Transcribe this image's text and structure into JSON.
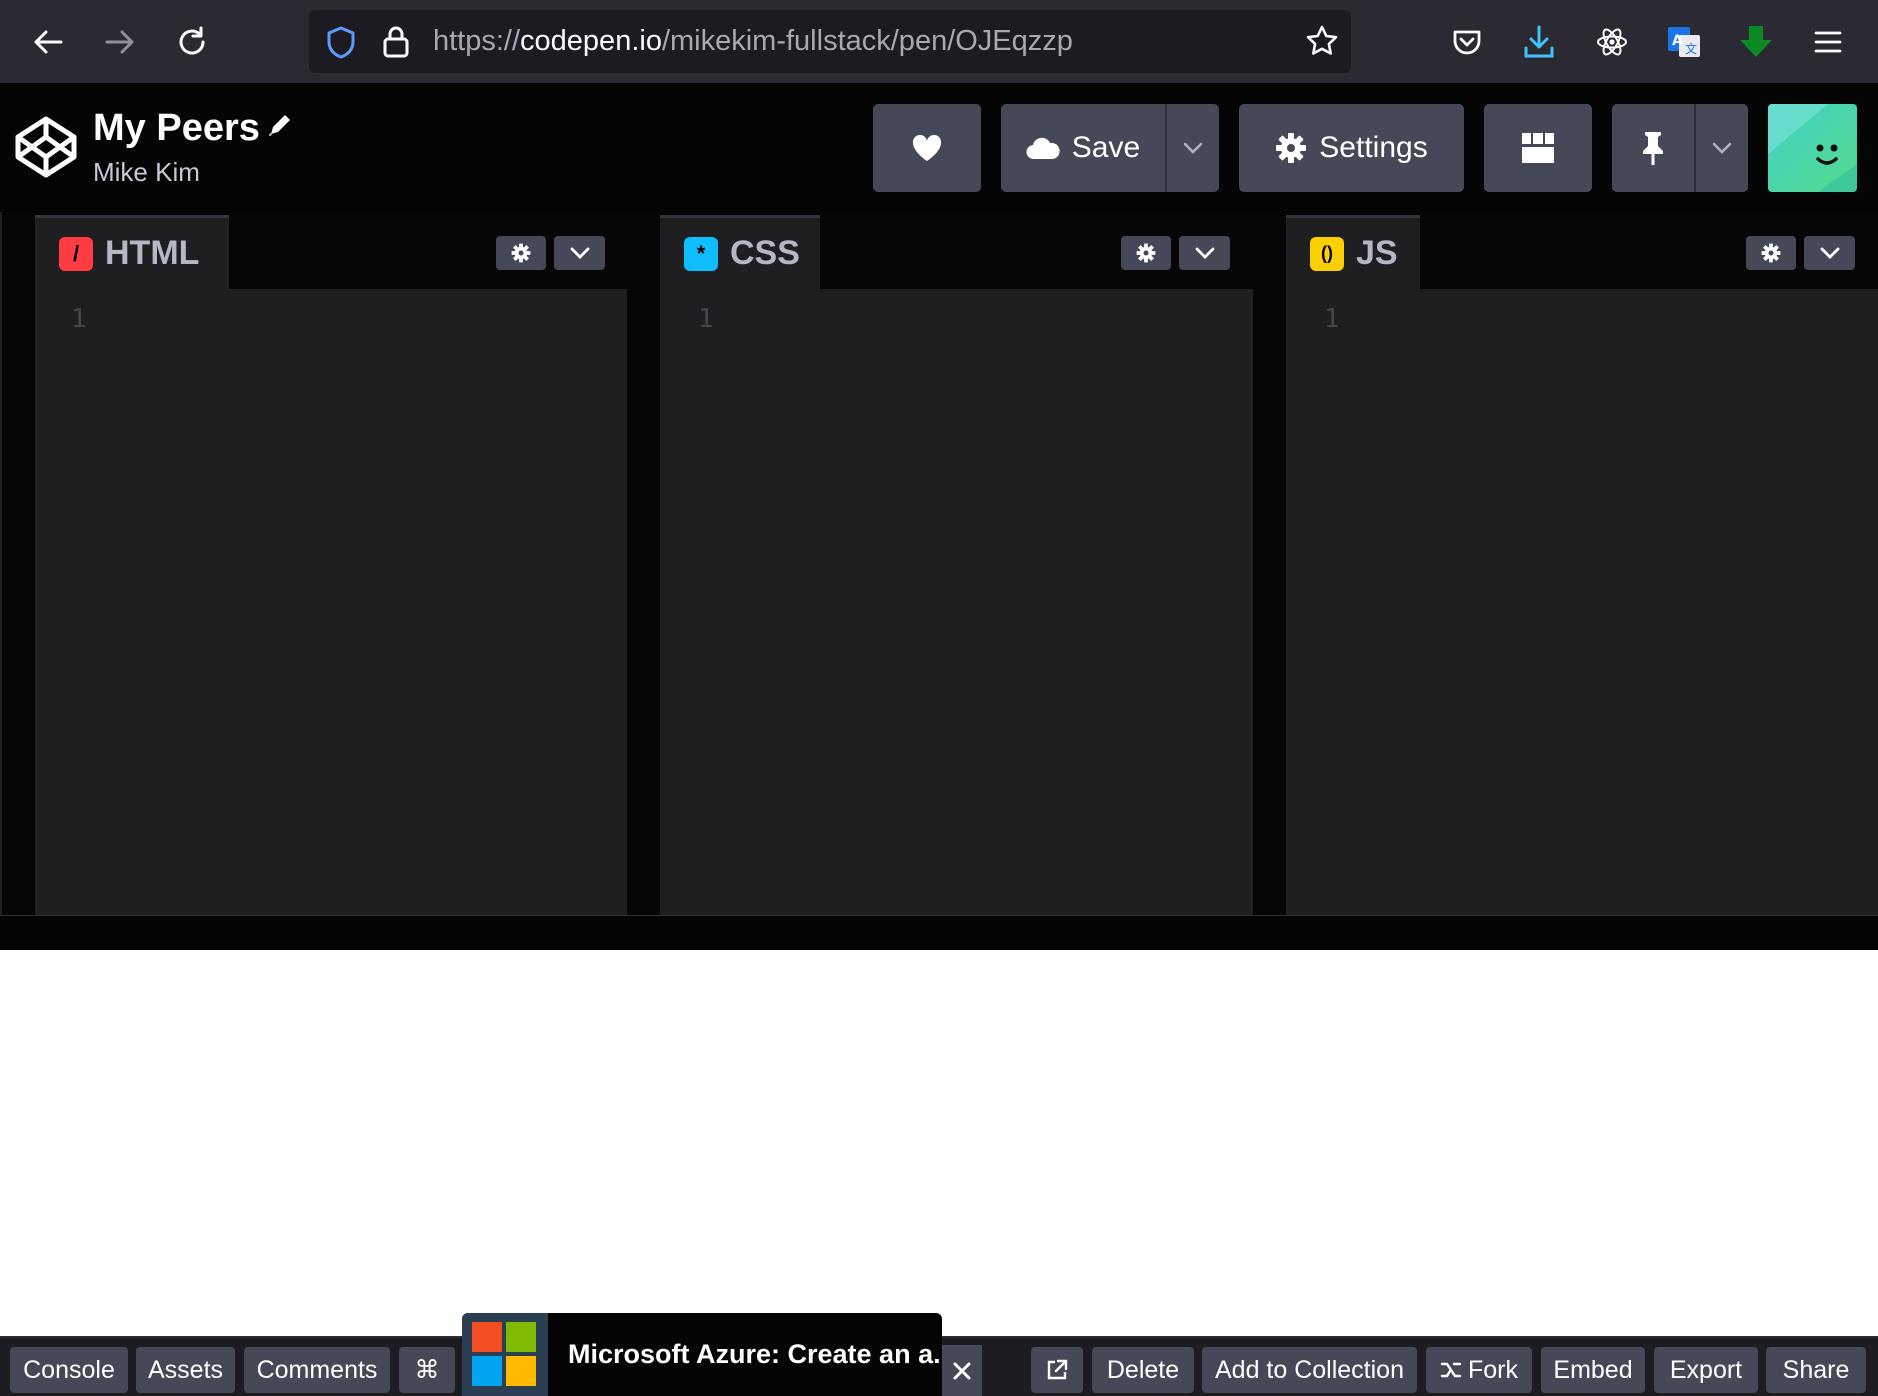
{
  "browser": {
    "url_scheme": "https://",
    "url_domain": "codepen.io",
    "url_path": "/mikekim-fullstack/pen/OJEqzzp",
    "icons": [
      "back-arrow-icon",
      "forward-arrow-icon",
      "reload-icon",
      "shield-icon",
      "lock-icon",
      "star-icon",
      "pocket-icon",
      "download-icon",
      "react-devtools-icon",
      "translate-icon",
      "green-download-icon",
      "hamburger-menu-icon"
    ]
  },
  "header": {
    "pen_title": "My Peers",
    "author": "Mike Kim",
    "save_label": "Save",
    "settings_label": "Settings"
  },
  "editors": [
    {
      "label": "HTML",
      "badge_glyph": "/",
      "badge_color": "#ff3c41",
      "line": "1"
    },
    {
      "label": "CSS",
      "badge_glyph": "*",
      "badge_color": "#0ebeff",
      "line": "1"
    },
    {
      "label": "JS",
      "badge_glyph": "()",
      "badge_color": "#fcd000",
      "line": "1"
    }
  ],
  "footer": {
    "console": "Console",
    "assets": "Assets",
    "comments": "Comments",
    "shortcut_glyph": "⌘",
    "ad_text": "Microsoft Azure: Create an a...",
    "delete": "Delete",
    "add_to_collection": "Add to Collection",
    "fork": "Fork",
    "embed": "Embed",
    "export": "Export",
    "share": "Share"
  },
  "colors": {
    "browser_bg": "#2b2a33",
    "header_bg": "#050505",
    "button_bg": "#444857",
    "editor_bg": "#1f1f22"
  }
}
